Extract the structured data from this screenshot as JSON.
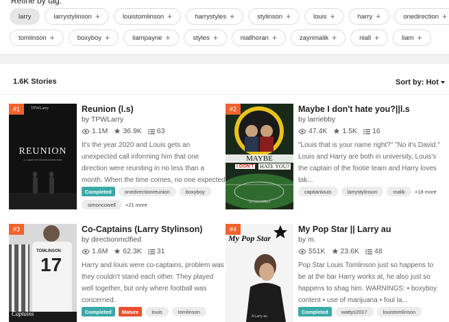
{
  "refine": {
    "title": "Refine by tag:",
    "row1": [
      {
        "label": "larry",
        "active": true
      },
      {
        "label": "larrystylinson"
      },
      {
        "label": "louistomlinson"
      },
      {
        "label": "harrystyles"
      },
      {
        "label": "stylinson"
      },
      {
        "label": "louis"
      },
      {
        "label": "harry"
      },
      {
        "label": "onedirection"
      }
    ],
    "row2": [
      {
        "label": "tomlinson"
      },
      {
        "label": "boxyboy"
      },
      {
        "label": "liampayne"
      },
      {
        "label": "styles"
      },
      {
        "label": "niallhoran"
      },
      {
        "label": "zaynmalik"
      },
      {
        "label": "niall"
      },
      {
        "label": "liam"
      }
    ]
  },
  "results": {
    "count": "1.6K Stories",
    "sort_label": "Sort by: Hot"
  },
  "stories": [
    {
      "rank": "#1",
      "title": "Reunion (l.s)",
      "author": "by TPWLarry",
      "reads": "1.1M",
      "votes": "36.9K",
      "parts": "63",
      "description": "It's the year 2020 and Louis gets an unexpected call informing him that one direction were reuniting in no less than a month. When the time comes, no one expected Harry...",
      "tags": [
        {
          "label": "Completed",
          "kind": "completed"
        },
        {
          "label": "onedirectionreunion"
        },
        {
          "label": "boxyboy"
        },
        {
          "label": "simoncowell"
        }
      ],
      "more": "+21 more",
      "cover": {
        "top_text": "TPWLarry",
        "title": "REUNION",
        "subtitle": "A LARRY STYLINSON FANFICTION"
      }
    },
    {
      "rank": "#2",
      "title": "Maybe I don't hate you?||l.s",
      "author": "by larriebby",
      "reads": "47.4K",
      "votes": "1.5K",
      "parts": "16",
      "description": "\"Louis that is your name right?\" \"No it's David.\" Louis and Harry are both in university, Louis's the captain of the footie team and Harry loves tak...",
      "tags": [
        {
          "label": "captianlouis"
        },
        {
          "label": "larrystylinson"
        },
        {
          "label": "malik"
        }
      ],
      "more": "+18 more",
      "cover": {
        "title_a": "MAYBE",
        "title_b": "I DON'T",
        "title_c": "HATE YOU?",
        "footer": "by cuupanlaaryul"
      }
    },
    {
      "rank": "#3",
      "title": "Co-Captains (Larry Stylinson)",
      "author": "by directionmclfied",
      "reads": "1.6M",
      "votes": "62.3K",
      "parts": "31",
      "description": "Harry and louis were co-captains, problem was they couldn't stand each other. They played well together, but only where football was concerned.",
      "tags": [
        {
          "label": "Completed",
          "kind": "completed"
        },
        {
          "label": "Mature",
          "kind": "mature"
        },
        {
          "label": "louis"
        },
        {
          "label": "tomlinson"
        }
      ],
      "more": "",
      "cover": {
        "jersey_name": "TOMLINSON",
        "jersey_number": "17",
        "title": "Captains"
      }
    },
    {
      "rank": "#4",
      "title": "My Pop Star || Larry au",
      "author": "by m.",
      "reads": "551K",
      "votes": "23.6K",
      "parts": "48",
      "description": "Pop Star Louis Tomlinson just so happens to be at the bar Harry works at, he also just so happens to shag him. WARNINGS: • boxyboy content • use of marijuana • foul la...",
      "tags": [
        {
          "label": "Completed",
          "kind": "completed"
        },
        {
          "label": "wattys2017"
        },
        {
          "label": "louistomlinson"
        }
      ],
      "more": "",
      "cover": {
        "title": "My Pop Star",
        "footer": "A Larry au"
      }
    }
  ],
  "colors": {
    "badge": "#f0632e",
    "completed": "#3aaaa8",
    "mature": "#e8502f"
  }
}
